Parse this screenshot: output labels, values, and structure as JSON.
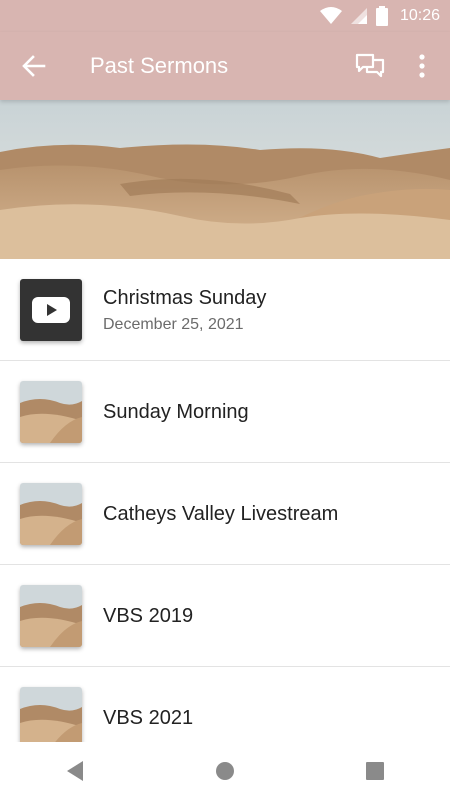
{
  "status_bar": {
    "time": "10:26"
  },
  "app_bar": {
    "title": "Past Sermons"
  },
  "sermons": [
    {
      "title": "Christmas Sunday",
      "date": "December 25, 2021",
      "thumb": "youtube-icon"
    },
    {
      "title": "Sunday Morning",
      "thumb": "desert-image"
    },
    {
      "title": "Catheys Valley Livestream",
      "thumb": "desert-image"
    },
    {
      "title": "VBS 2019",
      "thumb": "desert-image"
    },
    {
      "title": "VBS 2021",
      "thumb": "desert-image"
    }
  ],
  "colors": {
    "app_bar": "#d8b5b1",
    "sand": "#c9a27a",
    "sky": "#cfd7da",
    "youtube_tile": "#333333"
  }
}
